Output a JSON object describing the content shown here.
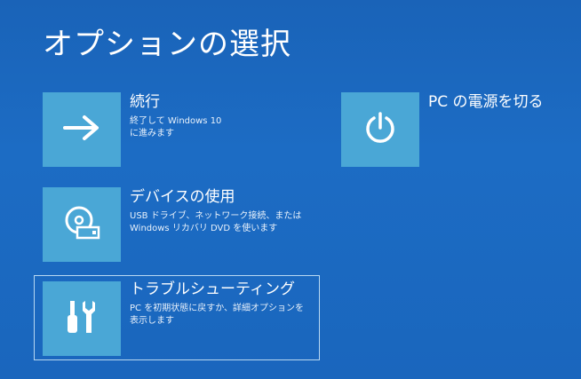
{
  "page": {
    "title": "オプションの選択"
  },
  "options": {
    "continue": {
      "title": "続行",
      "desc_line1": "終了して Windows 10",
      "desc_line2": "に進みます",
      "icon": "arrow-right-icon"
    },
    "device": {
      "title": "デバイスの使用",
      "desc_line1": "USB ドライブ、ネットワーク接続、または",
      "desc_line2": "Windows リカバリ DVD を使います",
      "icon": "disc-drive-icon"
    },
    "troubleshoot": {
      "title": "トラブルシューティング",
      "desc_line1": "PC を初期状態に戻すか、詳細オプションを",
      "desc_line2": "表示します",
      "icon": "tools-icon"
    },
    "power": {
      "title": "PC の電源を切る",
      "icon": "power-icon"
    }
  },
  "colors": {
    "background": "#1c6cc4",
    "tile": "#4aa7d6",
    "text": "#ffffff"
  }
}
